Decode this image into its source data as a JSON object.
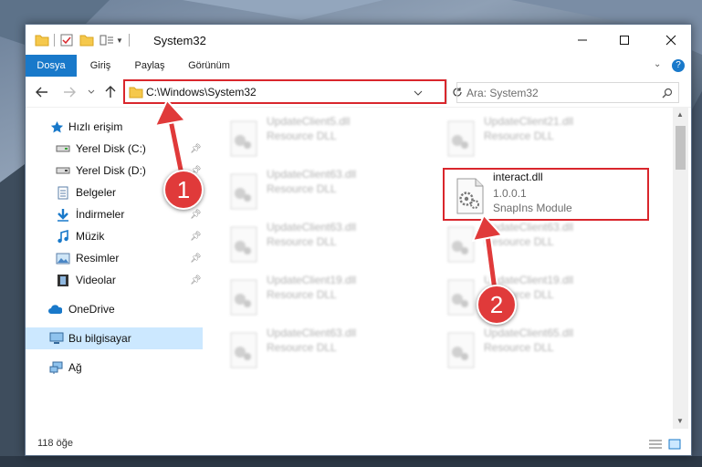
{
  "window": {
    "title": "System32"
  },
  "ribbon": {
    "tabs": [
      {
        "label": "Dosya",
        "active": true
      },
      {
        "label": "Giriş",
        "active": false
      },
      {
        "label": "Paylaş",
        "active": false
      },
      {
        "label": "Görünüm",
        "active": false
      }
    ]
  },
  "address": {
    "path": "C:\\Windows\\System32"
  },
  "search": {
    "placeholder": "Ara: System32"
  },
  "sidebar": {
    "items": [
      {
        "label": "Hızlı erişim",
        "icon": "star-icon"
      },
      {
        "label": "Yerel Disk (C:)",
        "icon": "drive-icon",
        "pinned": true
      },
      {
        "label": "Yerel Disk (D:)",
        "icon": "drive-icon",
        "pinned": true
      },
      {
        "label": "Belgeler",
        "icon": "documents-icon",
        "pinned": true
      },
      {
        "label": "İndirmeler",
        "icon": "download-icon",
        "pinned": true
      },
      {
        "label": "Müzik",
        "icon": "music-icon",
        "pinned": true
      },
      {
        "label": "Resimler",
        "icon": "pictures-icon",
        "pinned": true
      },
      {
        "label": "Videolar",
        "icon": "videos-icon",
        "pinned": true
      },
      {
        "label": "OneDrive",
        "icon": "cloud-icon"
      },
      {
        "label": "Bu bilgisayar",
        "icon": "computer-icon",
        "selected": true
      },
      {
        "label": "Ağ",
        "icon": "network-icon"
      }
    ]
  },
  "files": {
    "blurred": [
      {
        "name": "UpdateClient5.dll",
        "desc": "Resource DLL"
      },
      {
        "name": "UpdateClient21.dll",
        "desc": "Resource DLL"
      },
      {
        "name": "UpdateClient63.dll",
        "desc": "Resource DLL"
      },
      {
        "name": "UpdateClient63.dll",
        "desc": "Resource DLL"
      },
      {
        "name": "UpdateClient63.dll",
        "desc": "Resource DLL"
      },
      {
        "name": "UpdateClient19.dll",
        "desc": "Resource DLL"
      },
      {
        "name": "UpdateClient19.dll",
        "desc": "Resource DLL"
      },
      {
        "name": "UpdateClient63.dll",
        "desc": "Resource DLL"
      },
      {
        "name": "UpdateClient65.dll",
        "desc": "Resource DLL"
      }
    ],
    "highlighted": {
      "name": "interact.dll",
      "version": "1.0.0.1",
      "desc": "SnapIns Module"
    }
  },
  "status": {
    "count": "118 öğe"
  },
  "annotations": {
    "badge1": "1",
    "badge2": "2",
    "color": "#e03a3a"
  }
}
